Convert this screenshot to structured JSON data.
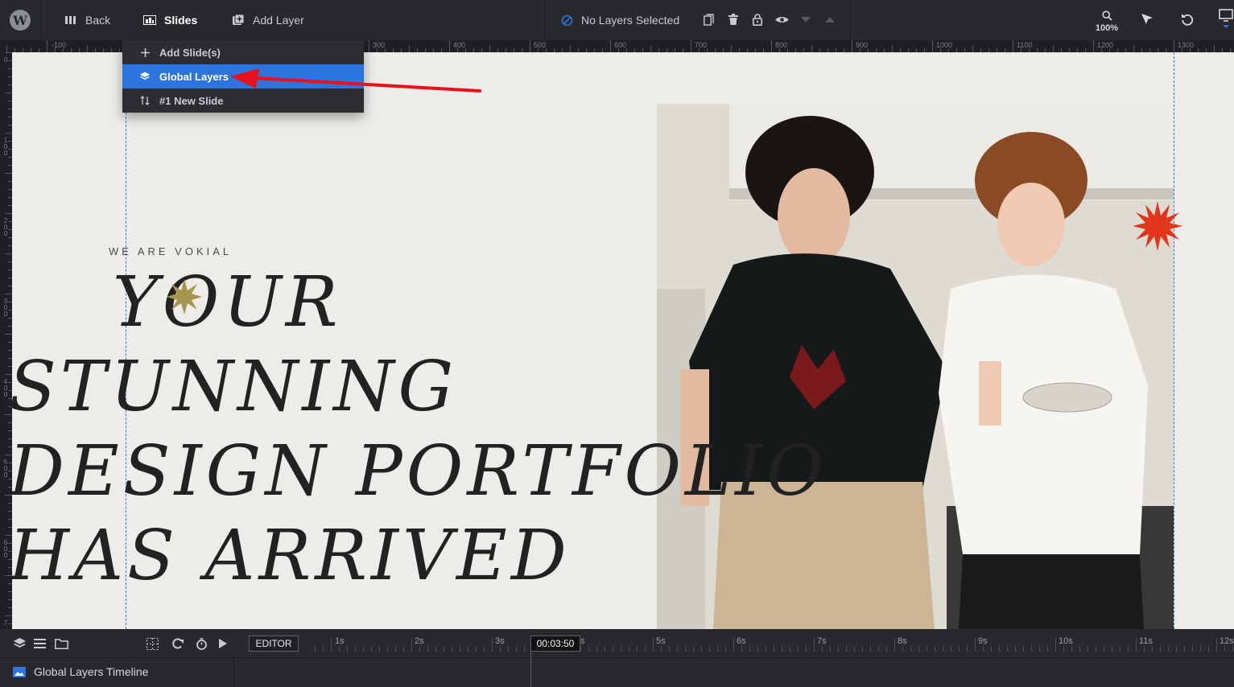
{
  "toolbar": {
    "back_label": "Back",
    "slides_label": "Slides",
    "add_layer_label": "Add Layer",
    "selection_status": "No Layers Selected",
    "zoom_level": "100%"
  },
  "icons": {
    "wordpress": "wordpress-logo",
    "back": "grid-columns-icon",
    "slides": "slides-icon",
    "add_layer": "plus-square-icon",
    "no_selection": "no-entry-icon",
    "duplicate": "copy-icon",
    "delete": "trash-icon",
    "lock": "lock-icon",
    "visibility": "eye-icon",
    "move_down": "triangle-down-icon",
    "move_up": "triangle-up-icon",
    "zoom": "magnifier-icon",
    "cursor": "cursor-icon",
    "undo": "undo-icon",
    "device": "desktop-icon"
  },
  "colors": {
    "accent": "#2e74dd",
    "toolbar_bg": "#27292d",
    "canvas_bg": "#eeece8",
    "annotation_arrow": "#e8101a",
    "star_olive": "#a69650",
    "star_red": "#e0371a"
  },
  "ruler": {
    "horizontal_labels": [
      "-100",
      "300",
      "400",
      "500",
      "600",
      "700",
      "800",
      "900",
      "1000",
      "1100",
      "1200",
      "1300"
    ],
    "vertical_labels": [
      "0",
      "100",
      "200",
      "300",
      "400",
      "500",
      "600",
      "7"
    ]
  },
  "slides_menu": {
    "items": [
      {
        "label": "Add Slide(s)",
        "icon": "plus-icon",
        "active": false
      },
      {
        "label": "Global Layers",
        "icon": "layers-icon",
        "active": true
      },
      {
        "label": "#1 New Slide",
        "icon": "sort-icon",
        "active": false
      }
    ]
  },
  "canvas": {
    "kicker": "WE ARE VOKIAL",
    "headline_lines": [
      "YOUR",
      "STUNNING",
      "DESIGN PORTFOLIO",
      "HAS ARRIVED"
    ]
  },
  "timeline": {
    "editor_label": "EDITOR",
    "current_time": "00:03:50",
    "seconds": [
      "1s",
      "2s",
      "3s",
      "s",
      "5s",
      "6s",
      "7s",
      "8s",
      "9s",
      "10s",
      "11s",
      "12s"
    ],
    "row_label": "Global Layers Timeline"
  }
}
